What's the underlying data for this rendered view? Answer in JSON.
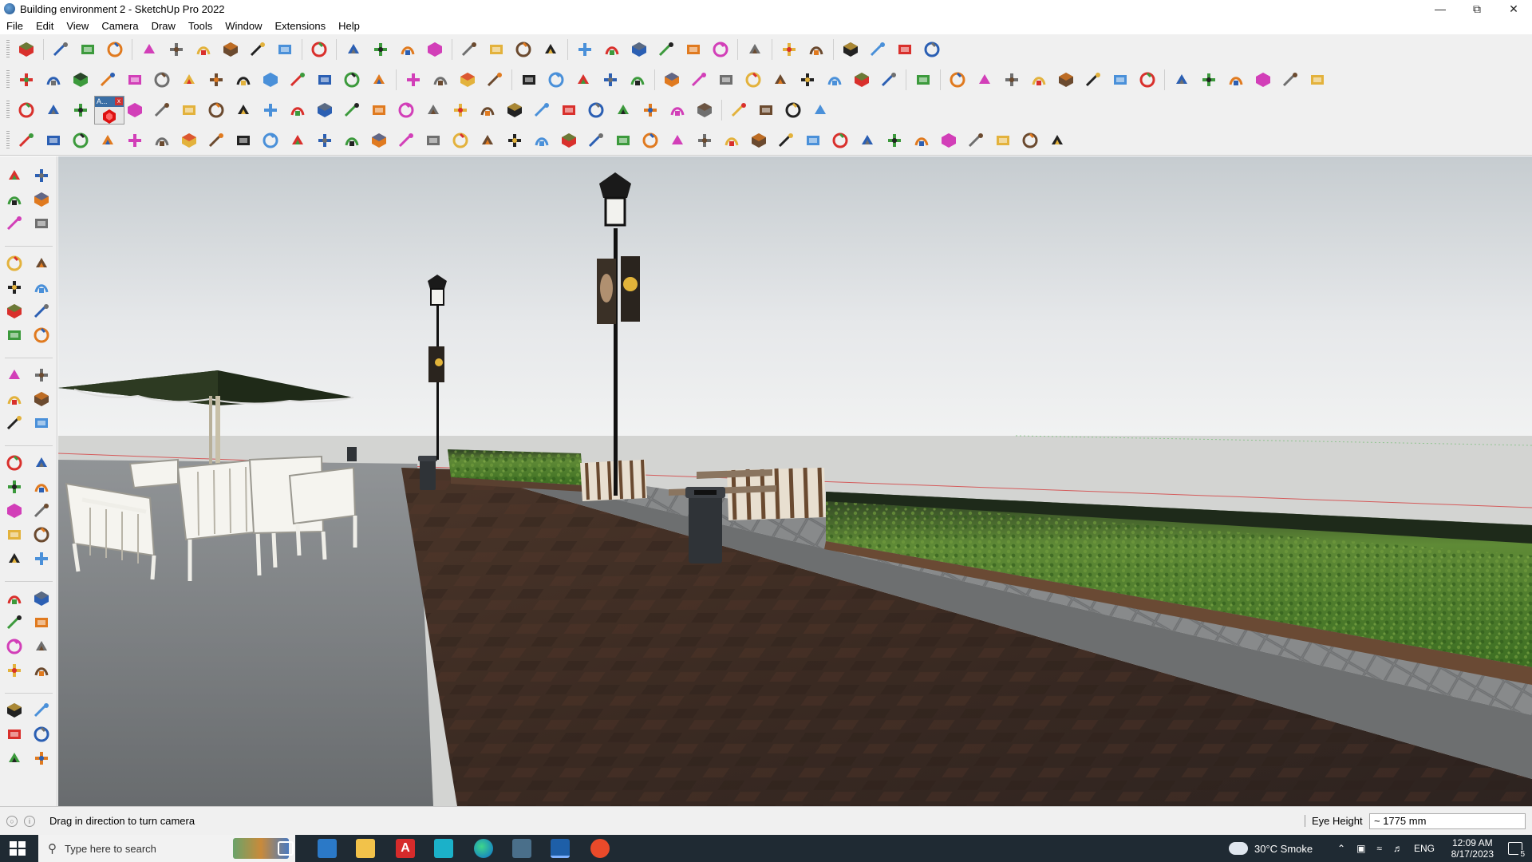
{
  "window": {
    "title": "Building environment 2 - SketchUp Pro 2022",
    "minimize_icon": "minimize-icon",
    "maximize_icon": "restore-icon",
    "close_icon": "close-icon"
  },
  "menu": [
    "File",
    "Edit",
    "View",
    "Camera",
    "Draw",
    "Tools",
    "Window",
    "Extensions",
    "Help"
  ],
  "toolbars": {
    "mini_panel_label": "A...",
    "colors": {
      "red": "#d9302c",
      "blue": "#2b5fb3",
      "green": "#3c9a3c",
      "orange": "#e07a1f",
      "magenta": "#d23fb8",
      "grey": "#6f6f6f"
    }
  },
  "statusbar": {
    "hint": "Drag in direction to turn camera",
    "measure_label": "Eye Height",
    "measure_value": "~ 1775 mm"
  },
  "taskbar": {
    "search_placeholder": "Type here to search",
    "weather": "30°C  Smoke",
    "language": "ENG",
    "time": "12:09 AM",
    "date": "8/17/2023",
    "notification_count": "5"
  }
}
